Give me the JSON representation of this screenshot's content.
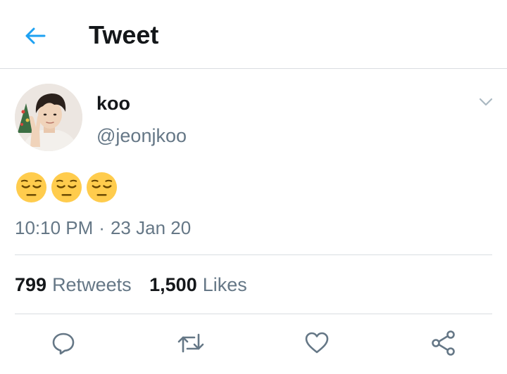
{
  "header": {
    "back_icon": "arrow-left-icon",
    "title": "Tweet",
    "accent_color": "#1da1f2"
  },
  "tweet": {
    "author": {
      "display_name": "koo",
      "handle": "@jeonjkoo",
      "avatar_icon": "profile-photo"
    },
    "more_icon": "chevron-down-icon",
    "text": "😔😔😔",
    "timestamp": {
      "time": "10:10 PM",
      "separator": "·",
      "date": "23 Jan 20"
    },
    "stats": {
      "retweets_count": "799",
      "retweets_label": "Retweets",
      "likes_count": "1,500",
      "likes_label": "Likes"
    },
    "actions": [
      {
        "name": "reply",
        "icon": "reply-icon"
      },
      {
        "name": "retweet",
        "icon": "retweet-icon"
      },
      {
        "name": "like",
        "icon": "heart-icon"
      },
      {
        "name": "share",
        "icon": "share-icon"
      }
    ]
  },
  "colors": {
    "text_primary": "#14171a",
    "text_secondary": "#657786",
    "divider": "#d9dde1",
    "icon_gray": "#657786"
  }
}
